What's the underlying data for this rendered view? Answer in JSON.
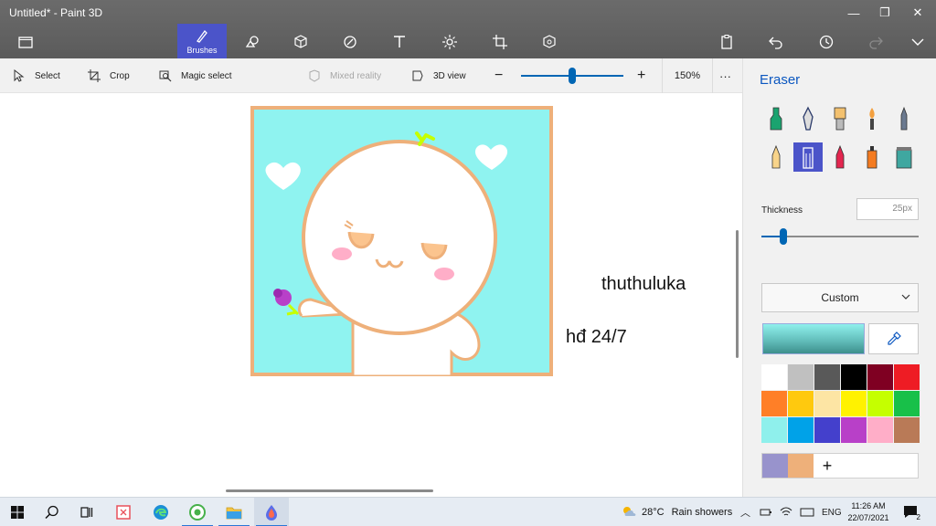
{
  "window": {
    "title": "Untitled* - Paint 3D",
    "minimize_glyph": "—",
    "maximize_glyph": "❐",
    "close_glyph": "✕"
  },
  "toolbar": {
    "active_tool_label": "Brushes",
    "icons": [
      "menu-folder-icon",
      "brushes-icon",
      "2d-shapes-icon",
      "3d-shapes-icon",
      "stickers-icon",
      "text-icon",
      "effects-icon",
      "canvas-icon",
      "3d-library-icon",
      "paste-icon",
      "undo-icon",
      "history-icon",
      "redo-icon",
      "expand-icon"
    ]
  },
  "commandbar": {
    "select": "Select",
    "crop": "Crop",
    "magic_select": "Magic select",
    "mixed_reality": "Mixed reality",
    "view_3d": "3D view",
    "zoom_percent": "150%",
    "zoom_level": 0.5,
    "more": "···"
  },
  "canvas": {
    "text_1": "thuthuluka",
    "text_2": "hđ 24/7",
    "background_color": "#8ff3f0",
    "border_color": "#eeb07a"
  },
  "panel": {
    "title": "Eraser",
    "thickness_label": "Thickness",
    "thickness_value": "25px",
    "thickness_level": 0.14,
    "color_mode": "Custom",
    "current_color": "#8ff0ec",
    "palette": [
      "#ffffff",
      "#c0c0c0",
      "#595959",
      "#000000",
      "#7f0022",
      "#ee1c24",
      "#ff7f27",
      "#ffc90e",
      "#fde5a4",
      "#fff200",
      "#c5ff00",
      "#18c049",
      "#8ff0ec",
      "#00a2e8",
      "#4440cc",
      "#b840c8",
      "#ffaec8",
      "#b97a57"
    ],
    "custom_colors": [
      "#9893cc",
      "#eeb07a"
    ],
    "add_color": "+"
  },
  "taskbar": {
    "weather_temp": "28°C",
    "weather_text": "Rain showers",
    "language": "ENG",
    "time": "11:26 AM",
    "date": "22/07/2021",
    "notification_count": "2"
  }
}
